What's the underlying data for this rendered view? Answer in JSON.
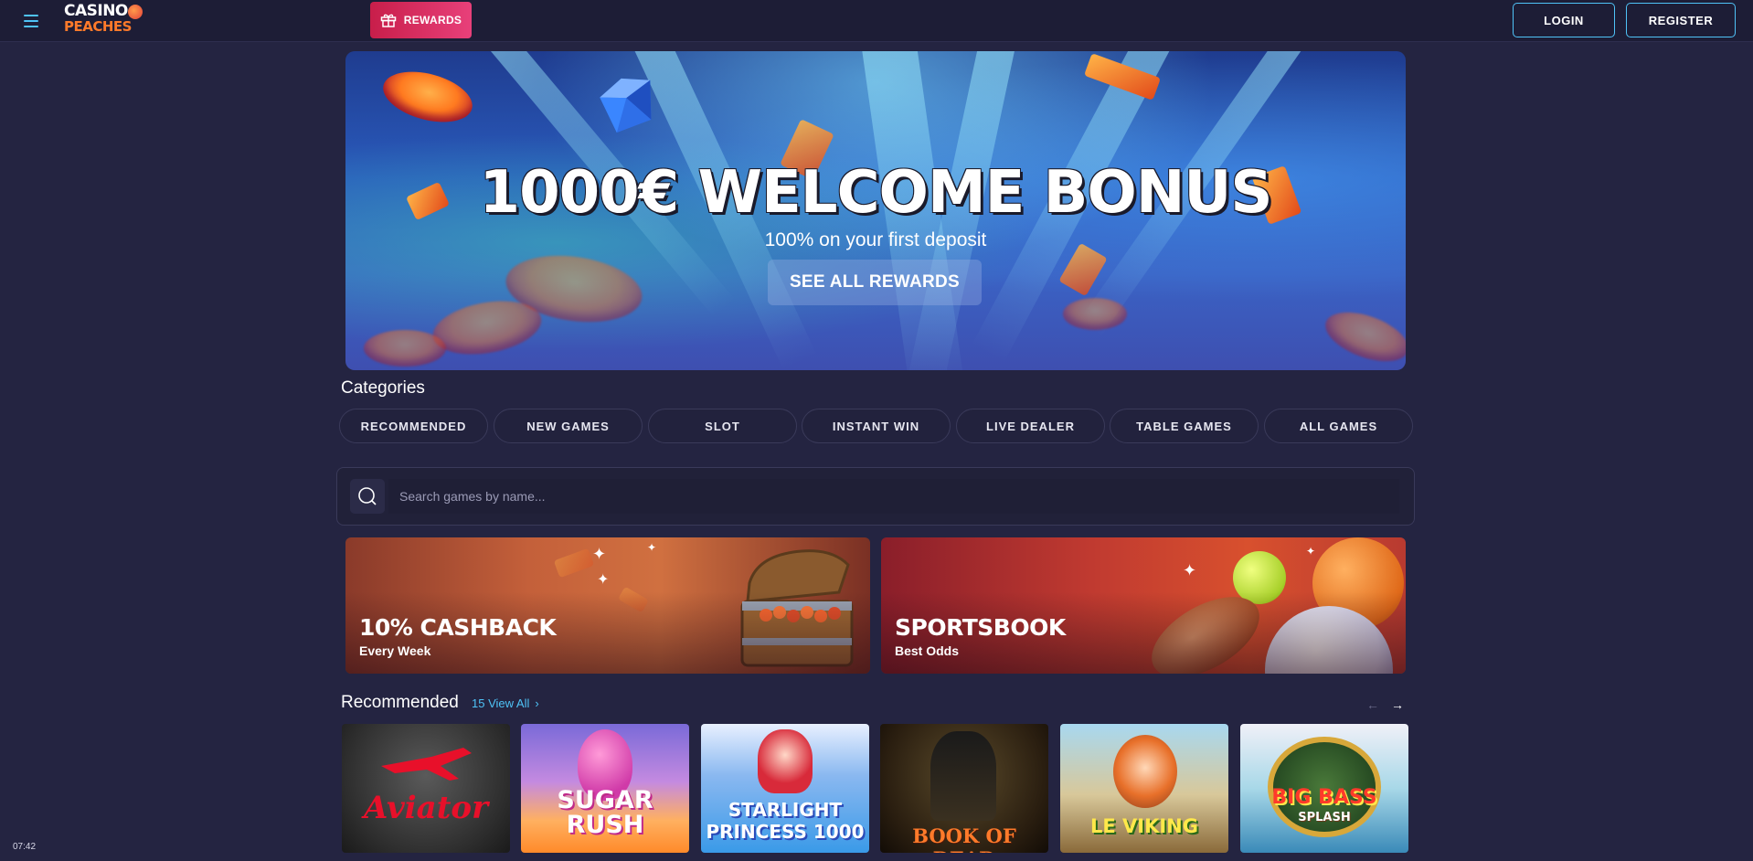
{
  "header": {
    "logo_line1": "CASINO",
    "logo_line2": "PEACHES",
    "rewards_label": "REWARDS",
    "login_label": "LOGIN",
    "register_label": "REGISTER"
  },
  "hero": {
    "title": "1000€ WELCOME BONUS",
    "subtitle": "100% on your first deposit",
    "cta_label": "SEE ALL REWARDS"
  },
  "categories": {
    "heading": "Categories",
    "items": [
      "RECOMMENDED",
      "NEW GAMES",
      "SLOT",
      "INSTANT WIN",
      "LIVE DEALER",
      "TABLE GAMES",
      "ALL GAMES"
    ]
  },
  "search": {
    "placeholder": "Search games by name..."
  },
  "promos": [
    {
      "title": "10% CASHBACK",
      "subtitle": "Every Week"
    },
    {
      "title": "SPORTSBOOK",
      "subtitle": "Best Odds"
    }
  ],
  "recommended": {
    "heading": "Recommended",
    "view_all_label": "15 View All",
    "games": [
      {
        "title": "Aviator"
      },
      {
        "title_line1": "SUGAR",
        "title_line2": "RUSH"
      },
      {
        "title_line1": "STARLIGHT",
        "title_line2": "PRINCESS 1000"
      },
      {
        "title": "BOOK OF DEAD"
      },
      {
        "title": "LE VIKING"
      },
      {
        "title_line1": "BIG BASS",
        "title_line2": "SPLASH"
      }
    ]
  },
  "status": {
    "clock": "07:42"
  },
  "colors": {
    "background": "#242441",
    "accent": "#4fc3f7",
    "rewards": "#d4285a",
    "logo_orange": "#ff7a2a"
  }
}
